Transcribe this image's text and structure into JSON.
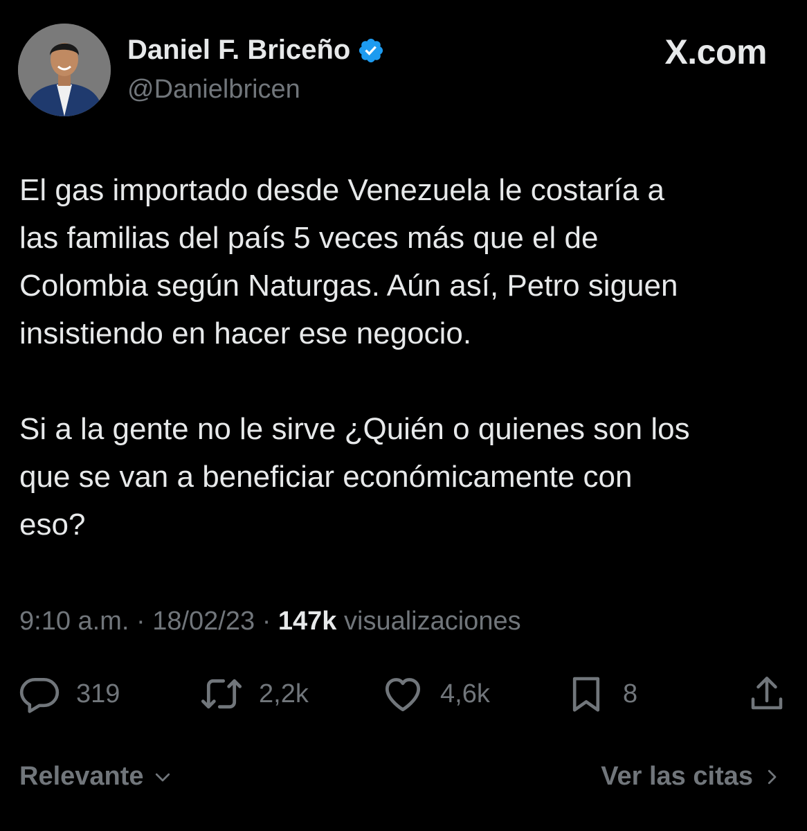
{
  "author": {
    "display_name": "Daniel F. Briceño",
    "handle": "@Danielbricen",
    "verified_color": "#1d9bf0"
  },
  "brand": "X.com",
  "tweet": {
    "paragraphs": [
      "El gas importado desde Venezuela le costaría a\nlas familias del país 5 veces más que el de\nColombia según Naturgas. Aún así, Petro siguen\ninsistiendo en hacer ese negocio.",
      "Si a la gente no le sirve ¿Quién o quienes son los\nque se van a beneficiar económicamente con\neso?"
    ]
  },
  "meta": {
    "time": "9:10 a.m.",
    "separator": "·",
    "date": "18/02/23",
    "views_count": "147k",
    "views_label": "visualizaciones"
  },
  "actions": {
    "replies": "319",
    "reposts": "2,2k",
    "likes": "4,6k",
    "bookmarks": "8"
  },
  "footer": {
    "sort_label": "Relevante",
    "quotes_link": "Ver las citas"
  },
  "colors": {
    "background": "#000000",
    "primary_text": "#e7e9ea",
    "secondary_text": "#71767b"
  }
}
